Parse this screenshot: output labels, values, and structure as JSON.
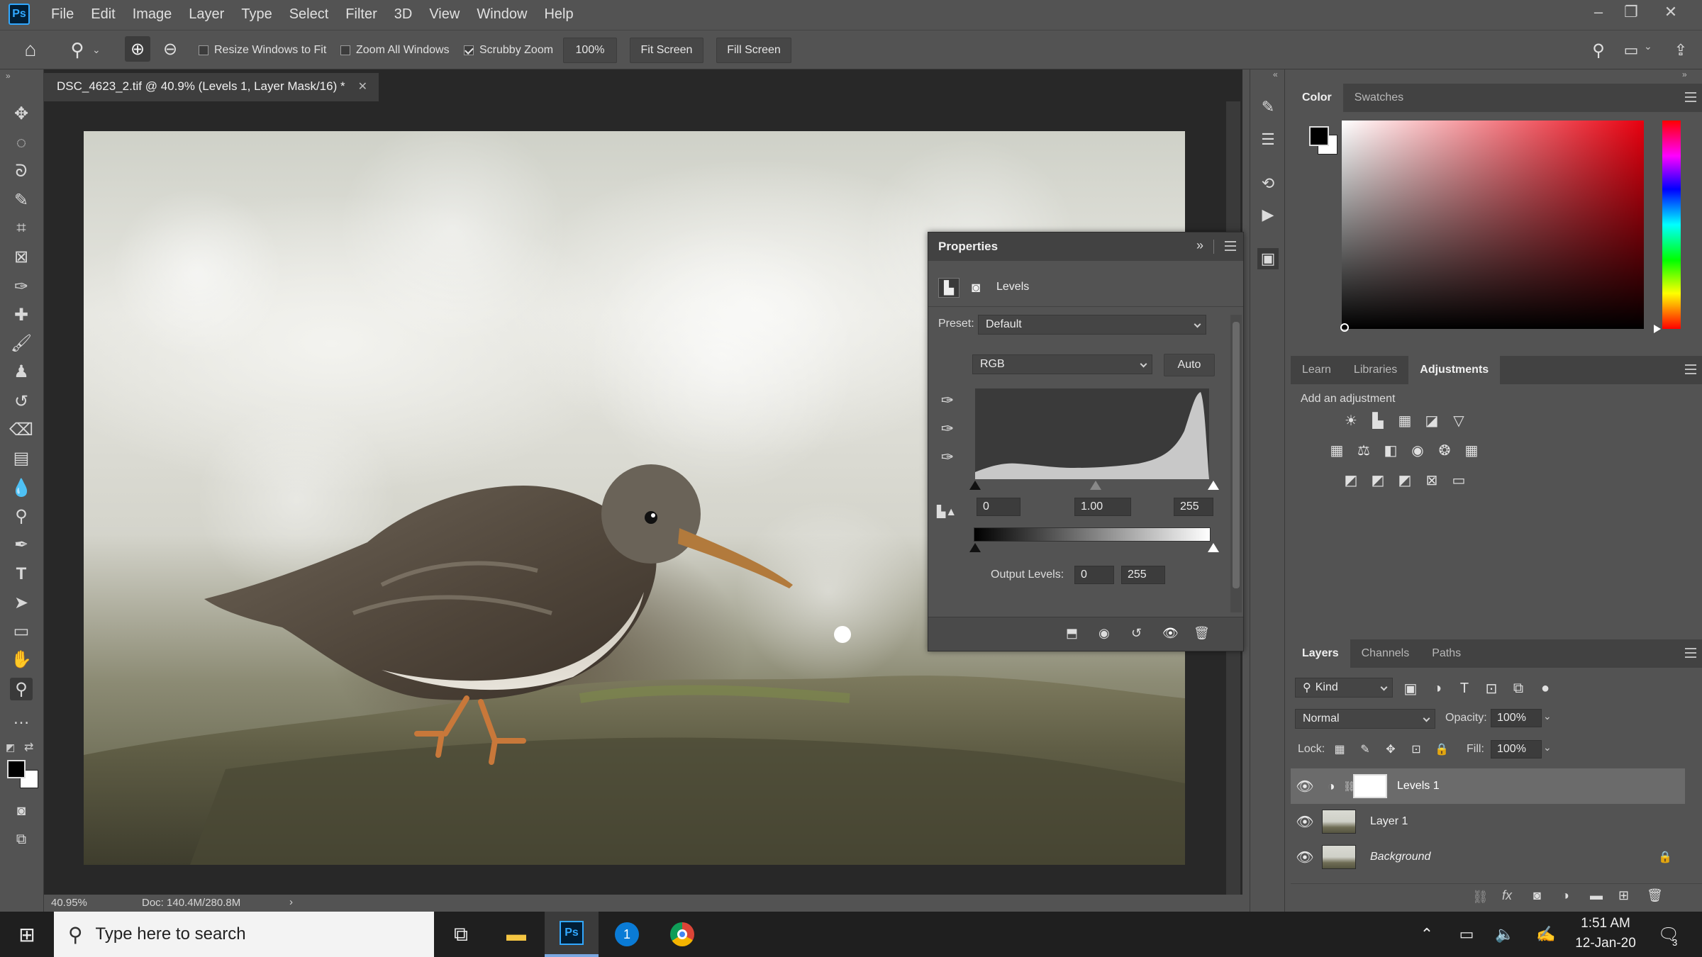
{
  "app": {
    "logo": "Ps"
  },
  "menu": [
    "File",
    "Edit",
    "Image",
    "Layer",
    "Type",
    "Select",
    "Filter",
    "3D",
    "View",
    "Window",
    "Help"
  ],
  "options": {
    "resize_windows": "Resize Windows to Fit",
    "zoom_all": "Zoom All Windows",
    "scrubby_zoom": "Scrubby Zoom",
    "zoom_value": "100%",
    "fit_screen": "Fit Screen",
    "fill_screen": "Fill Screen"
  },
  "document": {
    "tab_title": "DSC_4623_2.tif @ 40.9% (Levels 1, Layer Mask/16) *",
    "zoom": "40.95%",
    "doc_info": "Doc: 140.4M/280.8M"
  },
  "properties": {
    "title": "Properties",
    "adjustment": "Levels",
    "preset_label": "Preset:",
    "preset_value": "Default",
    "channel": "RGB",
    "auto": "Auto",
    "input_black": "0",
    "input_gamma": "1.00",
    "input_white": "255",
    "output_label": "Output Levels:",
    "output_black": "0",
    "output_white": "255"
  },
  "color_panel": {
    "tabs": [
      "Color",
      "Swatches"
    ],
    "active": "Color"
  },
  "adjust_panel": {
    "tabs": [
      "Learn",
      "Libraries",
      "Adjustments"
    ],
    "active": "Adjustments",
    "hint": "Add an adjustment"
  },
  "layers_panel": {
    "tabs": [
      "Layers",
      "Channels",
      "Paths"
    ],
    "active": "Layers",
    "filter": "Kind",
    "blend_mode": "Normal",
    "opacity_label": "Opacity:",
    "opacity": "100%",
    "lock_label": "Lock:",
    "fill_label": "Fill:",
    "fill": "100%",
    "layers": [
      {
        "name": "Levels 1"
      },
      {
        "name": "Layer 1"
      },
      {
        "name": "Background"
      }
    ]
  },
  "taskbar": {
    "search_placeholder": "Type here to search",
    "time": "1:51 AM",
    "date": "12-Jan-20",
    "notification_count": "3"
  }
}
